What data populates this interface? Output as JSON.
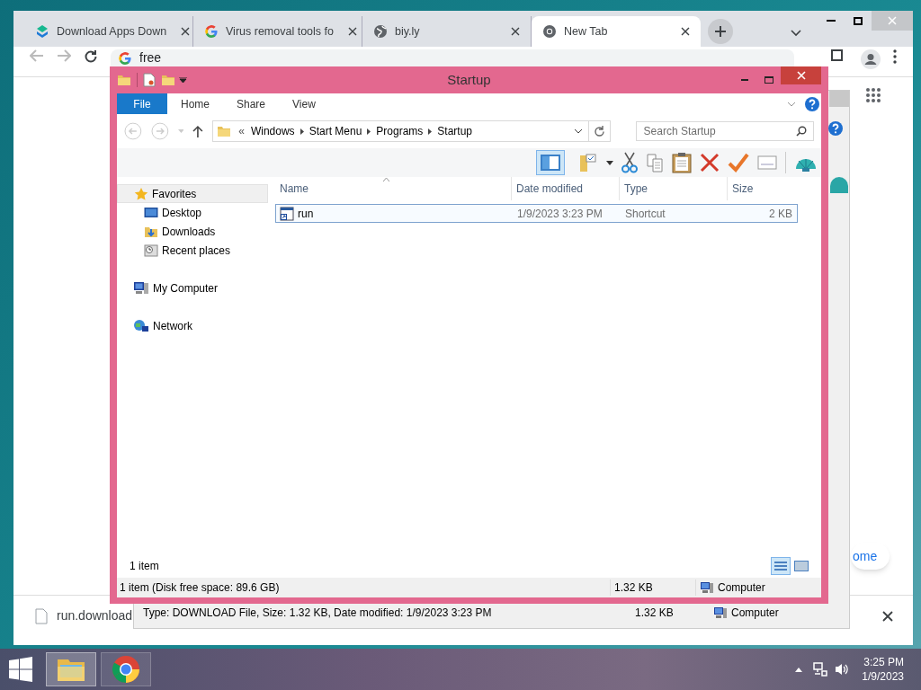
{
  "browser": {
    "tabs": [
      {
        "title": "Download Apps Down",
        "kind": "app",
        "selected": false
      },
      {
        "title": "Virus removal tools fo",
        "kind": "google",
        "selected": false
      },
      {
        "title": "biy.ly",
        "kind": "globe",
        "selected": false
      },
      {
        "title": "New Tab",
        "kind": "chrome",
        "selected": true
      }
    ],
    "address": "free",
    "promo_button": "ome",
    "download": {
      "filename": "run.download"
    }
  },
  "back_window": {
    "status_bar": [
      "Type: DOWNLOAD File, Size: 1.32 KB, Date modified: 1/9/2023 3:23 PM",
      "1.32 KB",
      "Computer"
    ]
  },
  "explorer": {
    "title": "Startup",
    "ribbon_tabs": [
      {
        "label": "File",
        "kind": "backstage"
      },
      {
        "label": "Home",
        "kind": "tab"
      },
      {
        "label": "Share",
        "kind": "tab"
      },
      {
        "label": "View",
        "kind": "tab"
      }
    ],
    "overflow_mark": "«",
    "path": [
      "Windows",
      "Start Menu",
      "Programs",
      "Startup"
    ],
    "search": {
      "placeholder": "Search Startup"
    },
    "nav": [
      {
        "label": "Favorites",
        "kind": "favorites",
        "selected": true,
        "children": [
          {
            "label": "Desktop",
            "kind": "desktop",
            "selected": false
          },
          {
            "label": "Downloads",
            "kind": "downloads",
            "selected": false
          },
          {
            "label": "Recent places",
            "kind": "recent",
            "selected": false
          }
        ]
      },
      {
        "label": "My Computer",
        "kind": "computer",
        "selected": false
      },
      {
        "label": "Network",
        "kind": "network",
        "selected": false
      }
    ],
    "columns": [
      "Name",
      "Date modified",
      "Type",
      "Size"
    ],
    "rows": [
      {
        "cells": [
          "run",
          "1/9/2023 3:23 PM",
          "Shortcut",
          "2 KB"
        ],
        "selected": true
      }
    ],
    "item_count": "1 item",
    "status_bar": [
      "1 item (Disk free space: 89.6 GB)",
      "1.32 KB",
      "Computer"
    ]
  },
  "taskbar": {
    "apps": [
      {
        "kind": "explorer",
        "selected": true
      },
      {
        "kind": "chrome",
        "selected": false
      }
    ],
    "time": "3:25 PM",
    "date": "1/9/2023"
  }
}
